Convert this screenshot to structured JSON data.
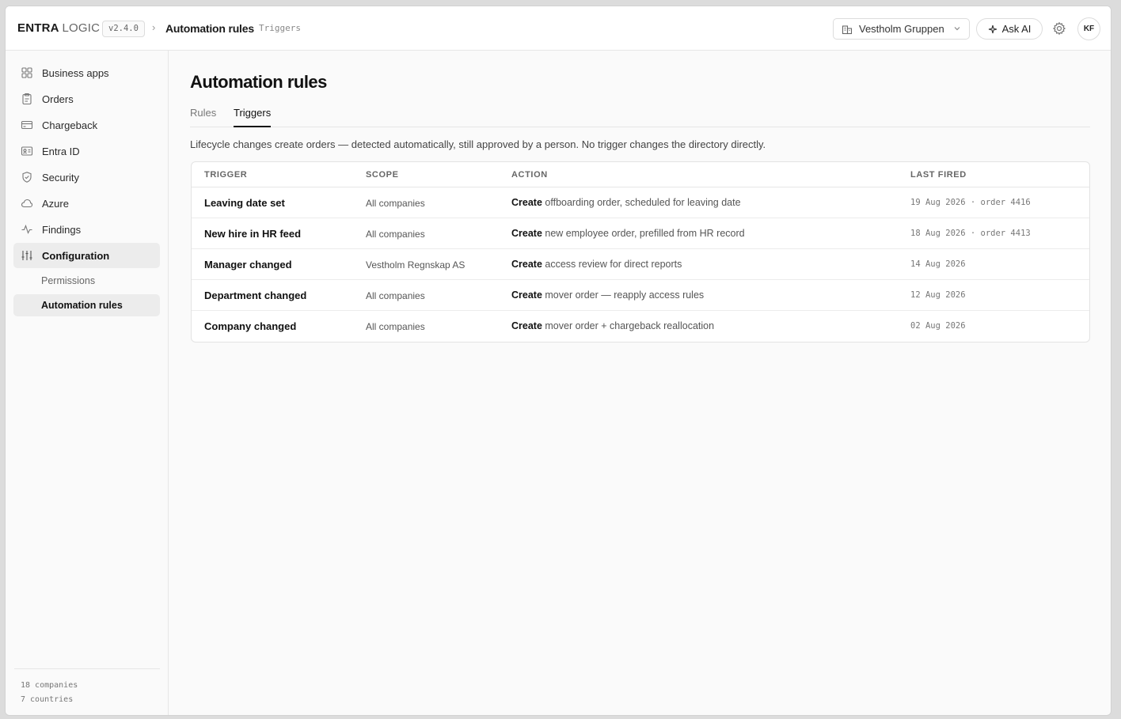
{
  "header": {
    "brand_bold": "ENTRA",
    "brand_light": "LOGIC",
    "version": "v2.4.0",
    "breadcrumb_separator": "›",
    "breadcrumb_title": "Automation rules",
    "breadcrumb_sub": "Triggers",
    "org_selector": "Vestholm Gruppen",
    "ask_ai": "Ask AI",
    "avatar_initials": "KF"
  },
  "sidebar": {
    "items": [
      {
        "label": "Business apps",
        "icon": "grid-icon"
      },
      {
        "label": "Orders",
        "icon": "clipboard-icon"
      },
      {
        "label": "Chargeback",
        "icon": "credit-card-icon"
      },
      {
        "label": "Entra ID",
        "icon": "id-card-icon"
      },
      {
        "label": "Security",
        "icon": "shield-icon"
      },
      {
        "label": "Azure",
        "icon": "cloud-icon"
      },
      {
        "label": "Findings",
        "icon": "activity-icon"
      },
      {
        "label": "Configuration",
        "icon": "sliders-icon",
        "active": true
      }
    ],
    "sub_items": [
      {
        "label": "Permissions"
      },
      {
        "label": "Automation rules",
        "active": true
      }
    ],
    "footer": {
      "companies": "18 companies",
      "countries": "7 countries"
    }
  },
  "main": {
    "title": "Automation rules",
    "tabs": [
      {
        "label": "Rules"
      },
      {
        "label": "Triggers",
        "active": true
      }
    ],
    "description": "Lifecycle changes create orders — detected automatically, still approved by a person. No trigger changes the directory directly.",
    "table": {
      "columns": [
        "TRIGGER",
        "SCOPE",
        "ACTION",
        "LAST FIRED"
      ],
      "rows": [
        {
          "trigger": "Leaving date set",
          "scope": "All companies",
          "action_verb": "Create",
          "action_rest": " offboarding order, scheduled for leaving date",
          "last_fired": "19 Aug 2026 · order 4416"
        },
        {
          "trigger": "New hire in HR feed",
          "scope": "All companies",
          "action_verb": "Create",
          "action_rest": " new employee order, prefilled from HR record",
          "last_fired": "18 Aug 2026 · order 4413"
        },
        {
          "trigger": "Manager changed",
          "scope": "Vestholm Regnskap AS",
          "action_verb": "Create",
          "action_rest": " access review for direct reports",
          "last_fired": "14 Aug 2026"
        },
        {
          "trigger": "Department changed",
          "scope": "All companies",
          "action_verb": "Create",
          "action_rest": " mover order — reapply access rules",
          "last_fired": "12 Aug 2026"
        },
        {
          "trigger": "Company changed",
          "scope": "All companies",
          "action_verb": "Create",
          "action_rest": " mover order + chargeback reallocation",
          "last_fired": "02 Aug 2026"
        }
      ]
    }
  }
}
